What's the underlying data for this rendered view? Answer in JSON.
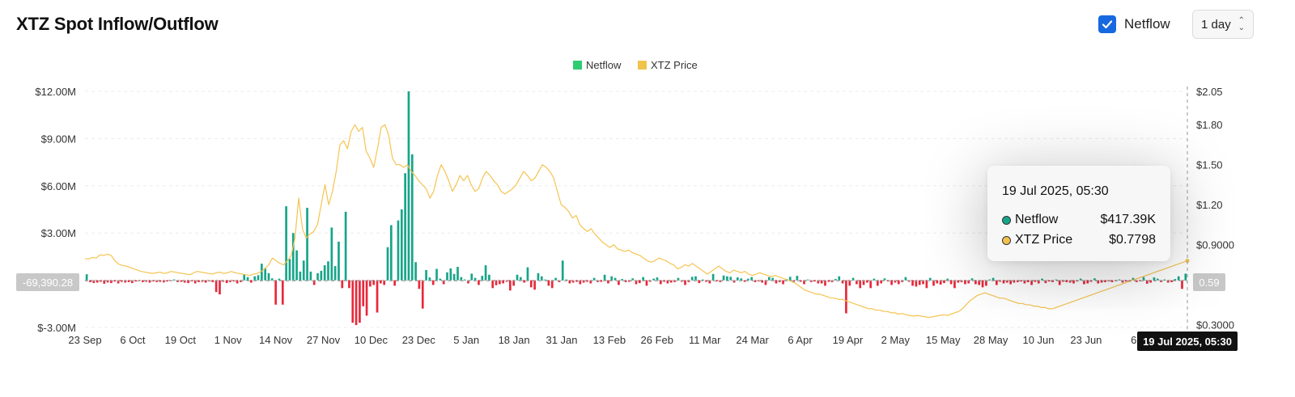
{
  "header": {
    "title": "XTZ Spot Inflow/Outflow",
    "netflow_toggle_label": "Netflow",
    "interval_value": "1 day"
  },
  "tooltip": {
    "date": "19 Jul 2025, 05:30",
    "rows": [
      {
        "label": "Netflow",
        "value": "$417.39K",
        "color": "#17a589"
      },
      {
        "label": "XTZ Price",
        "value": "$0.7798",
        "color": "#f2c14e"
      }
    ]
  },
  "crosshair": {
    "left_value": "-69,390.28",
    "right_value": "0.59",
    "x_value": "19 Jul 2025, 05:30"
  },
  "colors": {
    "inflow": "#17a589",
    "outflow": "#e8283a",
    "price": "#f5c451",
    "legend_netflow": "#2ecc71",
    "legend_price": "#f0c44c"
  },
  "chart_data": {
    "type": "bar",
    "legend": [
      "Netflow",
      "XTZ Price"
    ],
    "legend_position": "top-center",
    "grid": true,
    "x_tick_labels": [
      "23 Sep",
      "6 Oct",
      "19 Oct",
      "1 Nov",
      "14 Nov",
      "27 Nov",
      "10 Dec",
      "23 Dec",
      "5 Jan",
      "18 Jan",
      "31 Jan",
      "13 Feb",
      "26 Feb",
      "11 Mar",
      "24 Mar",
      "6 Apr",
      "19 Apr",
      "2 May",
      "15 May",
      "28 May",
      "10 Jun",
      "23 Jun",
      "6"
    ],
    "y_left": {
      "ticks": [
        "$12.00M",
        "$9.00M",
        "$6.00M",
        "$3.00M",
        "$-3.00M"
      ],
      "range": [
        -3.0,
        12.0
      ],
      "unit": "$M"
    },
    "y_right": {
      "ticks": [
        "$2.05",
        "$1.80",
        "$1.50",
        "$1.20",
        "$0.9000",
        "$0.3000"
      ],
      "range": [
        0.28,
        2.05
      ],
      "unit": "$"
    },
    "series": [
      {
        "name": "Netflow",
        "unit": "$M",
        "values": [
          0.38,
          -0.12,
          -0.18,
          -0.15,
          -0.1,
          -0.22,
          -0.14,
          -0.18,
          -0.08,
          -0.2,
          -0.1,
          -0.15,
          -0.12,
          -0.18,
          -0.08,
          -0.05,
          -0.12,
          -0.1,
          -0.15,
          -0.08,
          -0.12,
          -0.1,
          -0.14,
          -0.08,
          -0.05,
          0.05,
          -0.12,
          -0.1,
          -0.15,
          -0.18,
          -0.08,
          -0.2,
          -0.12,
          -0.1,
          -0.15,
          -0.08,
          -0.12,
          -0.75,
          -0.9,
          -0.1,
          -0.18,
          -0.12,
          -0.08,
          -0.2,
          -0.12,
          0.35,
          0.2,
          -0.15,
          0.25,
          0.32,
          1.05,
          0.78,
          0.45,
          0.12,
          -1.55,
          0.1,
          -1.55,
          4.7,
          1.35,
          3.0,
          1.9,
          0.55,
          1.25,
          4.6,
          0.55,
          -0.3,
          0.45,
          0.6,
          0.95,
          1.2,
          3.35,
          0.9,
          2.45,
          -0.5,
          4.35,
          -0.5,
          -2.7,
          -2.85,
          -2.7,
          -1.65,
          -2.25,
          -0.4,
          -0.3,
          -2.05,
          -0.2,
          -0.3,
          2.1,
          3.5,
          -0.35,
          3.8,
          4.5,
          6.8,
          12.0,
          8.0,
          1.15,
          -0.55,
          -1.8,
          0.65,
          0.18,
          -0.3,
          0.72,
          0.1,
          -0.25,
          0.5,
          0.75,
          0.4,
          0.85,
          0.2,
          0.05,
          -0.2,
          0.42,
          0.15,
          -0.3,
          0.28,
          0.95,
          0.35,
          -0.5,
          -0.32,
          -0.25,
          -0.2,
          -0.1,
          -0.65,
          -0.35,
          0.35,
          0.2,
          -0.15,
          0.82,
          -0.45,
          -0.6,
          0.45,
          0.25,
          0.05,
          -0.35,
          -0.5,
          0.15,
          -0.12,
          1.25,
          0.05,
          -0.2,
          -0.15,
          -0.1,
          -0.25,
          -0.15,
          -0.1,
          -0.2,
          0.15,
          -0.12,
          -0.1,
          0.35,
          -0.2,
          0.25,
          0.15,
          -0.3,
          0.08,
          -0.12,
          -0.1,
          0.12,
          -0.25,
          -0.18,
          0.2,
          -0.35,
          -0.1,
          0.1,
          0.18,
          -0.25,
          -0.1,
          -0.2,
          -0.15,
          -0.12,
          0.15,
          -0.1,
          -0.3,
          -0.12,
          0.22,
          0.25,
          -0.18,
          0.05,
          -0.1,
          -0.2,
          0.4,
          -0.08,
          -0.12,
          0.3,
          0.25,
          0.22,
          -0.15,
          0.18,
          0.12,
          -0.1,
          0.1,
          0.2,
          -0.12,
          -0.08,
          -0.15,
          -0.3,
          0.2,
          0.15,
          -0.2,
          -0.12,
          -0.25,
          0.08,
          0.22,
          -0.15,
          0.28,
          -0.1,
          -0.25,
          0.05,
          -0.12,
          -0.08,
          -0.2,
          -0.2,
          -0.35,
          -0.1,
          -0.12,
          0.08,
          0.25,
          -0.2,
          -2.1,
          -0.35,
          0.15,
          -0.25,
          -0.5,
          -0.3,
          -0.15,
          -0.5,
          0.1,
          -0.35,
          -0.2,
          0.12,
          -0.08,
          -0.3,
          -0.15,
          -0.25,
          -0.12,
          0.2,
          -0.1,
          -0.35,
          -0.4,
          -0.3,
          -0.25,
          -0.5,
          0.15,
          -0.35,
          -0.2,
          -0.28,
          -0.18,
          0.1,
          -0.25,
          -0.5,
          -0.15,
          -0.12,
          -0.25,
          -0.2,
          0.12,
          -0.25,
          -0.3,
          -0.45,
          -0.35,
          0.05,
          0.15,
          -0.3,
          -0.1,
          -0.2,
          -0.15,
          -0.25,
          -0.15,
          -0.12,
          -0.08,
          -0.2,
          -0.12,
          -0.3,
          -0.1,
          -0.2,
          0.1,
          -0.18,
          -0.08,
          -0.12,
          0.05,
          -0.3,
          -0.1,
          -0.12,
          -0.15,
          -0.2,
          -0.08,
          0.1,
          -0.25,
          -0.2,
          -0.1,
          0.12,
          -0.2,
          -0.15,
          -0.12,
          -0.08,
          -0.12,
          -0.05,
          0.05,
          -0.15,
          -0.08,
          -0.1,
          0.15,
          -0.12,
          -0.06,
          0.2,
          -0.22,
          -0.15,
          0.18,
          0.1,
          -0.12,
          0.05,
          -0.15,
          -0.12,
          0.08,
          0.25,
          -0.55,
          0.42
        ]
      },
      {
        "name": "XTZ Price",
        "unit": "$",
        "values": [
          0.795,
          0.795,
          0.805,
          0.8,
          0.825,
          0.82,
          0.83,
          0.82,
          0.78,
          0.755,
          0.745,
          0.74,
          0.73,
          0.72,
          0.71,
          0.7,
          0.695,
          0.69,
          0.685,
          0.69,
          0.695,
          0.685,
          0.69,
          0.7,
          0.695,
          0.69,
          0.685,
          0.68,
          0.675,
          0.69,
          0.7,
          0.695,
          0.69,
          0.685,
          0.68,
          0.69,
          0.695,
          0.685,
          0.69,
          0.7,
          0.69,
          0.685,
          0.68,
          0.675,
          0.67,
          0.68,
          0.685,
          0.7,
          0.72,
          0.75,
          0.8,
          0.78,
          0.76,
          0.75,
          0.78,
          0.82,
          0.95,
          1.25,
          1.02,
          0.95,
          0.98,
          1.0,
          1.05,
          1.2,
          1.35,
          1.2,
          1.3,
          1.45,
          1.65,
          1.68,
          1.62,
          1.75,
          1.8,
          1.75,
          1.78,
          1.6,
          1.55,
          1.48,
          1.62,
          1.78,
          1.8,
          1.72,
          1.55,
          1.5,
          1.5,
          1.48,
          1.5,
          1.45,
          1.42,
          1.38,
          1.35,
          1.32,
          1.25,
          1.3,
          1.42,
          1.5,
          1.45,
          1.38,
          1.3,
          1.35,
          1.42,
          1.38,
          1.42,
          1.35,
          1.3,
          1.32,
          1.4,
          1.45,
          1.42,
          1.38,
          1.35,
          1.3,
          1.28,
          1.3,
          1.32,
          1.35,
          1.4,
          1.45,
          1.42,
          1.38,
          1.4,
          1.45,
          1.5,
          1.48,
          1.45,
          1.4,
          1.3,
          1.2,
          1.18,
          1.15,
          1.1,
          1.12,
          1.05,
          1.02,
          1.0,
          1.02,
          0.98,
          0.95,
          0.92,
          0.9,
          0.88,
          0.9,
          0.87,
          0.86,
          0.85,
          0.86,
          0.84,
          0.83,
          0.82,
          0.8,
          0.78,
          0.77,
          0.78,
          0.8,
          0.79,
          0.78,
          0.76,
          0.75,
          0.72,
          0.73,
          0.75,
          0.74,
          0.76,
          0.74,
          0.72,
          0.7,
          0.68,
          0.7,
          0.72,
          0.74,
          0.72,
          0.7,
          0.69,
          0.71,
          0.7,
          0.69,
          0.7,
          0.68,
          0.67,
          0.68,
          0.69,
          0.68,
          0.67,
          0.66,
          0.67,
          0.66,
          0.65,
          0.64,
          0.63,
          0.62,
          0.6,
          0.58,
          0.56,
          0.55,
          0.54,
          0.53,
          0.53,
          0.52,
          0.51,
          0.5,
          0.5,
          0.49,
          0.49,
          0.48,
          0.47,
          0.46,
          0.45,
          0.44,
          0.43,
          0.42,
          0.42,
          0.41,
          0.41,
          0.4,
          0.4,
          0.39,
          0.39,
          0.38,
          0.385,
          0.375,
          0.37,
          0.365,
          0.37,
          0.365,
          0.36,
          0.355,
          0.36,
          0.365,
          0.37,
          0.375,
          0.37,
          0.38,
          0.39,
          0.4,
          0.42,
          0.45,
          0.48,
          0.5,
          0.52,
          0.53,
          0.54,
          0.53,
          0.52,
          0.51,
          0.5,
          0.5,
          0.49,
          0.48,
          0.47,
          0.46,
          0.46,
          0.45,
          0.45,
          0.44,
          0.44,
          0.43,
          0.43,
          0.42,
          0.42,
          0.43,
          0.44,
          0.45,
          0.46,
          0.47,
          0.48,
          0.49,
          0.5,
          0.51,
          0.52,
          0.53,
          0.54,
          0.55,
          0.56,
          0.57,
          0.58,
          0.59,
          0.6,
          0.61,
          0.62,
          0.63,
          0.64,
          0.65,
          0.66,
          0.67,
          0.68,
          0.69,
          0.7,
          0.71,
          0.72,
          0.73,
          0.74,
          0.75,
          0.76,
          0.77,
          0.78
        ]
      }
    ]
  }
}
